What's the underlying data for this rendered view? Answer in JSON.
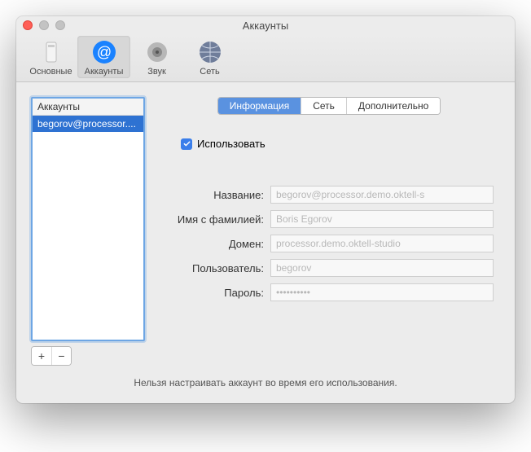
{
  "window": {
    "title": "Аккаунты"
  },
  "toolbar": {
    "items": [
      {
        "label": "Основные"
      },
      {
        "label": "Аккаунты"
      },
      {
        "label": "Звук"
      },
      {
        "label": "Сеть"
      }
    ]
  },
  "sidebar": {
    "header": "Аккаунты",
    "items": [
      {
        "label": "begorov@processor...."
      }
    ],
    "add_label": "+",
    "remove_label": "−"
  },
  "tabs": {
    "items": [
      {
        "label": "Информация"
      },
      {
        "label": "Сеть"
      },
      {
        "label": "Дополнительно"
      }
    ]
  },
  "use_checkbox": {
    "label": "Использовать",
    "checked": true
  },
  "form": {
    "name": {
      "label": "Название:",
      "value": "begorov@processor.demo.oktell-s"
    },
    "fullname": {
      "label": "Имя с фамилией:",
      "value": "Boris Egorov"
    },
    "domain": {
      "label": "Домен:",
      "value": "processor.demo.oktell-studio"
    },
    "user": {
      "label": "Пользователь:",
      "value": "begorov"
    },
    "password": {
      "label": "Пароль:",
      "value": "••••••••••"
    }
  },
  "footer": {
    "text": "Нельзя настраивать аккаунт во время его использования."
  }
}
